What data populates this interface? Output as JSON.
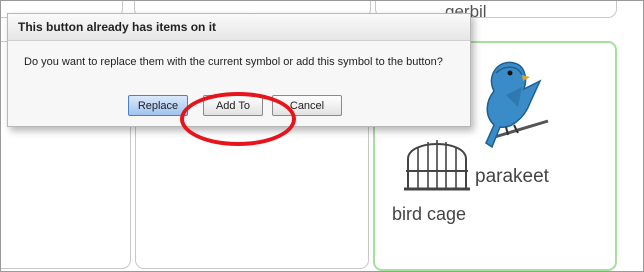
{
  "grid": {
    "top_right_label": "gerbil",
    "parakeet_label": "parakeet",
    "bird_cage_label": "bird cage"
  },
  "dialog": {
    "title": "This button already has items on it",
    "message": "Do you want to replace them with the current symbol or add this symbol to the button?",
    "buttons": {
      "replace": "Replace",
      "add_to": "Add To",
      "cancel": "Cancel"
    }
  },
  "colors": {
    "selected_cell_border": "#a8dea0",
    "highlight_ring": "#e8141b",
    "primary_button": "#9fc3ee",
    "bird_blue": "#3a8cc8"
  }
}
